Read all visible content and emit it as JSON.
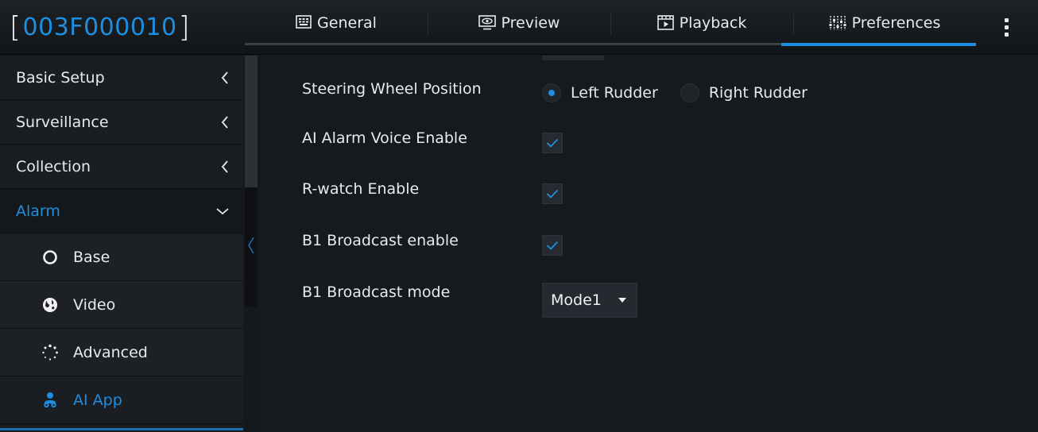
{
  "device": {
    "bracket_open": "[",
    "id": "003F000010",
    "bracket_close": "]"
  },
  "tabs": [
    {
      "label": "General",
      "icon": "keyboard-icon"
    },
    {
      "label": "Preview",
      "icon": "monitor-eye-icon"
    },
    {
      "label": "Playback",
      "icon": "film-play-icon"
    },
    {
      "label": "Preferences",
      "icon": "sliders-icon",
      "active": true
    }
  ],
  "sidebar": {
    "items": [
      {
        "label": "Basic Setup",
        "expanded": false
      },
      {
        "label": "Surveillance",
        "expanded": false
      },
      {
        "label": "Collection",
        "expanded": false
      },
      {
        "label": "Alarm",
        "expanded": true
      }
    ],
    "sub_items": [
      {
        "label": "Base",
        "icon": "circle-outline-icon"
      },
      {
        "label": "Video",
        "icon": "globe-icon"
      },
      {
        "label": "Advanced",
        "icon": "dotted-circle-icon"
      },
      {
        "label": "AI App",
        "icon": "user-group-icon",
        "active": true
      }
    ]
  },
  "settings": {
    "steering": {
      "label": "Steering Wheel Position",
      "options": [
        "Left Rudder",
        "Right Rudder"
      ],
      "selected": "Left Rudder"
    },
    "ai_alarm_voice": {
      "label": "AI Alarm Voice Enable",
      "checked": true
    },
    "r_watch": {
      "label": "R-watch Enable",
      "checked": true
    },
    "b1_broadcast": {
      "label": "B1 Broadcast enable",
      "checked": true
    },
    "b1_mode": {
      "label": "B1 Broadcast mode",
      "value": "Mode1"
    }
  },
  "colors": {
    "accent": "#1e8fe0",
    "background": "#14171b",
    "text": "#e8eaed"
  }
}
